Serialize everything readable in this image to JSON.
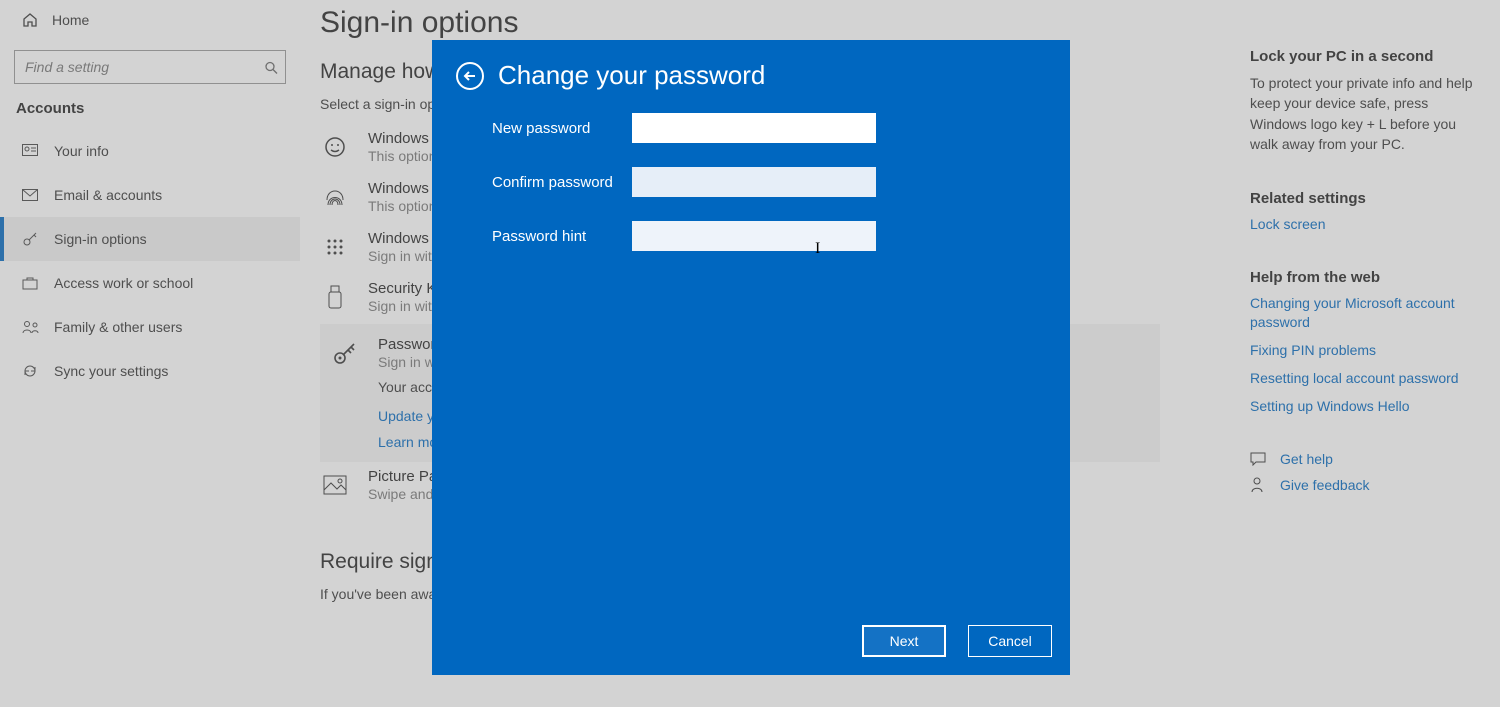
{
  "sidebar": {
    "home": "Home",
    "search_placeholder": "Find a setting",
    "section": "Accounts",
    "items": [
      {
        "icon": "person-card-icon",
        "label": "Your info"
      },
      {
        "icon": "mail-icon",
        "label": "Email & accounts"
      },
      {
        "icon": "key-icon",
        "label": "Sign-in options"
      },
      {
        "icon": "briefcase-icon",
        "label": "Access work or school"
      },
      {
        "icon": "people-icon",
        "label": "Family & other users"
      },
      {
        "icon": "sync-icon",
        "label": "Sync your settings"
      }
    ],
    "selected_index": 2
  },
  "main": {
    "title": "Sign-in options",
    "manage_heading": "Manage how you sign in to your device",
    "select_line": "Select a sign-in option to add, change, or remove it.",
    "options": [
      {
        "title": "Windows Hello Face",
        "sub": "This option is currently unavailable"
      },
      {
        "title": "Windows Hello Fingerprint",
        "sub": "This option is currently unavailable"
      },
      {
        "title": "Windows Hello PIN",
        "sub": "Sign in with a PIN (Recommended)"
      },
      {
        "title": "Security Key",
        "sub": "Sign in with a physical security key"
      },
      {
        "title": "Password",
        "sub": "Sign in with your account's password",
        "extra": "Your account password is all set up to sign in to Windows, apps and services.",
        "link1": "Update your security questions",
        "link2": "Learn more"
      },
      {
        "title": "Picture Password",
        "sub": "Swipe and tap your favorite photo to unlock your device"
      }
    ],
    "require_heading": "Require sign-in",
    "require_desc": "If you've been away, when should Windows require you to sign in again?"
  },
  "rightcol": {
    "lock_h": "Lock your PC in a second",
    "lock_p": "To protect your private info and help keep your device safe, press Windows logo key + L before you walk away from your PC.",
    "related_h": "Related settings",
    "related_link": "Lock screen",
    "help_h": "Help from the web",
    "help_links": [
      "Changing your Microsoft account password",
      "Fixing PIN problems",
      "Resetting local account password",
      "Setting up Windows Hello"
    ],
    "get_help": "Get help",
    "give_feedback": "Give feedback"
  },
  "modal": {
    "title": "Change your password",
    "new_label": "New password",
    "confirm_label": "Confirm password",
    "hint_label": "Password hint",
    "new_value": "",
    "confirm_value": "",
    "hint_value": "",
    "next": "Next",
    "cancel": "Cancel"
  }
}
